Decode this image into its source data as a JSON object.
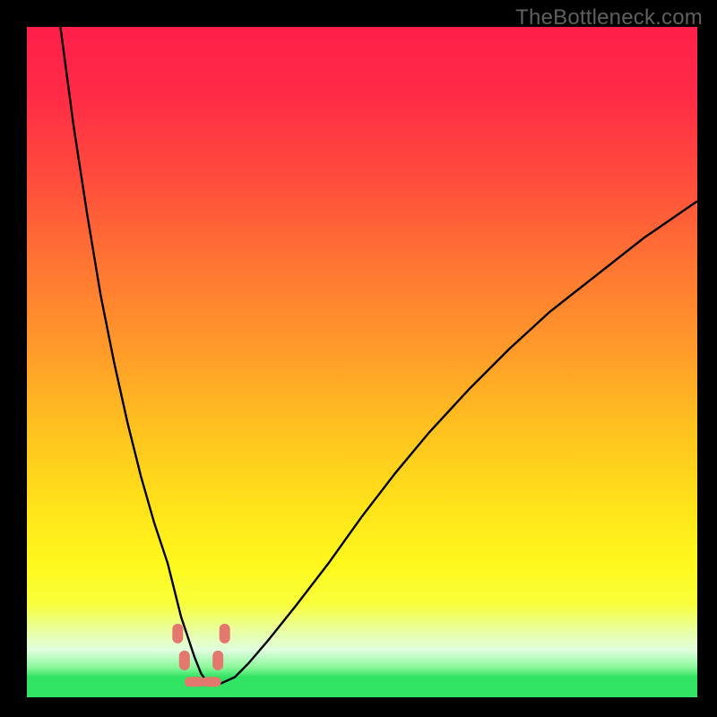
{
  "watermark": "TheBottleneck.com",
  "colors": {
    "frame": "#000000",
    "curve_stroke": "#000000",
    "marker_fill": "#e3786f",
    "bottom_band": "#30e363"
  },
  "gradient_stops": [
    {
      "offset": 0.0,
      "color": "#ff1f4a"
    },
    {
      "offset": 0.1,
      "color": "#ff2b46"
    },
    {
      "offset": 0.22,
      "color": "#ff4a3d"
    },
    {
      "offset": 0.35,
      "color": "#ff7433"
    },
    {
      "offset": 0.48,
      "color": "#ff9a2a"
    },
    {
      "offset": 0.6,
      "color": "#ffc21f"
    },
    {
      "offset": 0.72,
      "color": "#ffe41a"
    },
    {
      "offset": 0.8,
      "color": "#fff81e"
    },
    {
      "offset": 0.86,
      "color": "#f8ff3a"
    },
    {
      "offset": 0.9,
      "color": "#eaffa0"
    },
    {
      "offset": 0.93,
      "color": "#e0ffe0"
    },
    {
      "offset": 0.955,
      "color": "#8cf79a"
    },
    {
      "offset": 0.97,
      "color": "#30e363"
    },
    {
      "offset": 1.0,
      "color": "#30e363"
    }
  ],
  "chart_data": {
    "type": "line",
    "title": "",
    "xlabel": "",
    "ylabel": "",
    "xlim": [
      0,
      100
    ],
    "ylim": [
      0,
      100
    ],
    "x": [
      5,
      7,
      9,
      11,
      13,
      15,
      17,
      19,
      21,
      22,
      23,
      24,
      25,
      26,
      27,
      28,
      29,
      31,
      33,
      36,
      40,
      45,
      50,
      55,
      60,
      66,
      72,
      78,
      85,
      92,
      100
    ],
    "values": [
      100,
      85,
      72,
      60,
      50,
      41,
      33,
      26,
      20,
      16,
      12,
      9,
      6,
      3.5,
      2.2,
      2.0,
      2.1,
      3.0,
      5.0,
      8.5,
      13.5,
      20,
      27,
      33.5,
      39.5,
      46,
      52,
      57.5,
      63,
      68.5,
      74
    ],
    "markers": [
      {
        "x": 22.5,
        "y": 9.5
      },
      {
        "x": 23.5,
        "y": 5.5
      },
      {
        "x": 28.5,
        "y": 5.5
      },
      {
        "x": 29.5,
        "y": 9.5
      },
      {
        "x": 25.0,
        "y": 2.3
      },
      {
        "x": 27.5,
        "y": 2.3
      }
    ]
  }
}
